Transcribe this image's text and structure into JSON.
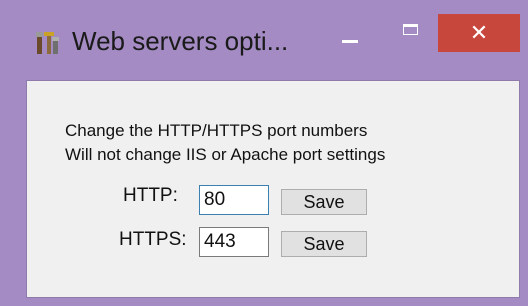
{
  "window": {
    "title": "Web servers opti...",
    "close_glyph": "✕",
    "accent_color": "#a48bc3",
    "close_color": "#c7473d"
  },
  "content": {
    "line1": "Change the HTTP/HTTPS port numbers",
    "line2": "Will not change IIS or Apache port settings"
  },
  "http": {
    "label": "HTTP:",
    "value": "80",
    "save_label": "Save"
  },
  "https": {
    "label": "HTTPS:",
    "value": "443",
    "save_label": "Save"
  },
  "icons": {
    "app": "tools-icon",
    "minimize": "minimize-icon",
    "maximize": "maximize-icon",
    "close": "close-icon"
  }
}
